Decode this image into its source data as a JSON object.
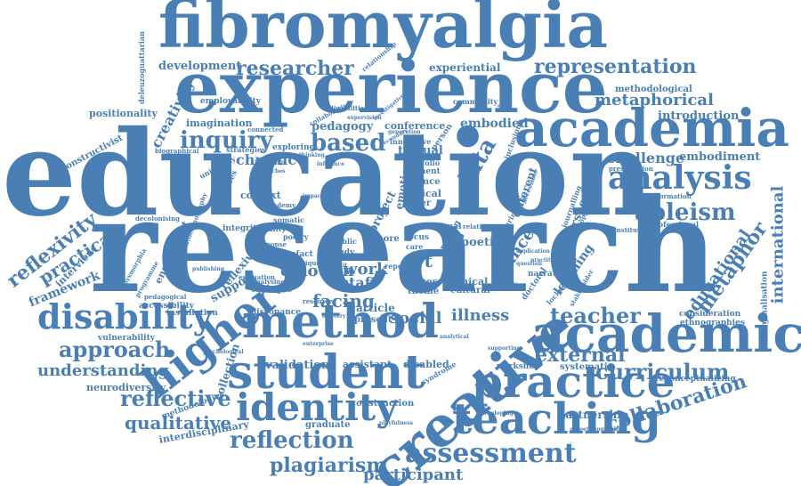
{
  "color": "#4a7fb5",
  "words": {
    "fibromyalgia": "fibromyalgia",
    "experience": "experience",
    "education": "education",
    "research": "research",
    "academia": "academia",
    "method": "method",
    "academic": "academic",
    "student": "student",
    "practice": "practice",
    "creative": "creative",
    "teaching": "teaching",
    "identity": "identity",
    "higher": "higher",
    "disability": "disability",
    "analysis": "analysis",
    "representation": "representation",
    "researcher": "researcher",
    "development": "development",
    "metaphorical": "metaphorical",
    "inquiry": "inquiry",
    "based": "based",
    "ableism": "ableism",
    "reflexivity": "reflexivity",
    "practical": "practical",
    "approach": "approach",
    "understanding": "understanding",
    "reflective": "reflective",
    "qualitative": "qualitative",
    "reflection": "reflection",
    "plagiarism": "plagiarism",
    "assessment": "assessment",
    "participant": "participant",
    "curriculum": "curriculum",
    "collaboration": "collaboration",
    "teacher": "teacher",
    "external": "external",
    "metaphor": "metaphor",
    "international": "international",
    "educational": "educational",
    "challenge": "challenge",
    "embodiment": "embodiment",
    "introduction": "introduction",
    "creativity": "creativity",
    "positionality": "positionality",
    "framework": "framework",
    "experiential": "experiential",
    "data": "data",
    "pedagogy": "pedagogy",
    "chronic": "chronic",
    "emotion": "emotion",
    "staff": "staff",
    "work": "work",
    "social": "social",
    "illness": "illness",
    "art": "art",
    "facing": "facing",
    "dance": "dance",
    "partnership": "partnership",
    "validation": "validation",
    "embodied": "embodied",
    "methodological": "methodological",
    "conference": "conference",
    "textual": "textual",
    "imagination": "imagination",
    "constructivist": "constructivist",
    "context": "context",
    "neurodiversity": "neurodiversity",
    "interdisciplinary": "interdisciplinary",
    "vulnerability": "vulnerability",
    "employability": "employability",
    "exploring": "exploring",
    "strategies": "strategies",
    "interview": "interview",
    "engagement": "engagement",
    "support": "support",
    "reflexive": "reflexive",
    "collection": "collection",
    "example": "example",
    "installation": "installation",
    "accessibility": "accessibility",
    "assistant": "assistant",
    "disabled": "disabled",
    "construction": "construction",
    "graduate": "graduate",
    "systematic": "systematic",
    "workshop": "workshop",
    "consideration": "consideration",
    "ethnographies": "ethnographies",
    "marginalisation": "marginalisation",
    "reconceptualizing": "reconceptualizing",
    "professional": "professional",
    "poetic": "poetic",
    "ethical": "ethical",
    "cultural": "cultural",
    "perspective": "perspective",
    "learning": "learning",
    "narrative": "narrative",
    "doctoral": "doctoral",
    "making": "making",
    "project": "project",
    "article": "article",
    "present": "present",
    "space": "space",
    "study": "study",
    "theme": "theme",
    "boxes": "boxes",
    "critical": "critical",
    "paper": "paper",
    "science": "science",
    "element": "element",
    "portfolio": "portfolio",
    "primary": "primary",
    "person": "person",
    "innovative": "innovative",
    "community": "community",
    "relationship": "relationship",
    "deleuzoguattarian": "deleuzoguattarian",
    "dissonance": "dissonance",
    "resource": "resource",
    "integrity": "integrity",
    "somatic": "somatic",
    "equality": "equality",
    "poetry": "poetry",
    "artefact": "artefact",
    "response": "response",
    "critique": "critique",
    "methodologies": "methodologies",
    "processes": "processes",
    "academy": "academy",
    "biographical": "biographical",
    "connected": "connected",
    "collaborative": "collaborative",
    "disabilities": "disabilities",
    "decolonising": "decolonising",
    "autoethnography": "autoethnography",
    "dysmorphia": "dysmorphia",
    "programme": "programme",
    "pedagogical": "pedagogical",
    "analysing": "analysing",
    "evaluation": "evaluation",
    "university": "university",
    "journalling": "journalling",
    "opportunities": "opportunities",
    "institutional": "institutional",
    "presentation": "presentation",
    "information": "information",
    "lockdown": "lockdown",
    "application": "application",
    "question": "question",
    "delivery": "delivery",
    "enterprise": "enterprise",
    "supporting": "supporting",
    "syndrome": "syndrome",
    "analytical": "analytical",
    "developing": "developing",
    "playfulness": "playfulness",
    "autoethnographic": "autoethnographic",
    "psychological": "psychological",
    "public": "public",
    "focus": "focus",
    "more": "more",
    "care": "care",
    "visual": "visual",
    "relation": "relation",
    "report": "report",
    "publishing": "publishing",
    "investigative": "investigative",
    "supervision": "supervision",
    "generation": "generation",
    "secondary": "secondary",
    "inclusion": "inclusion",
    "experimental": "experimental",
    "students": "students",
    "staffs": "staffs",
    "interpretation": "interpretation",
    "outcome": "outcome",
    "thinking": "thinking",
    "sharing": "sharing",
    "knowledge": "knowledge",
    "approaches": "approaches",
    "influence": "influence",
    "thematic": "thematic",
    "fiction": "fiction",
    "pedagogies": "pedagogies",
    "cognitive": "cognitive",
    "emotional": "emotional",
    "training": "training",
    "invisible": "invisible",
    "different": "different",
    "accessible": "accessible",
    "physical": "physical",
    "mental": "mental",
    "health": "health",
    "toolkit": "toolkit",
    "ethic": "ethic",
    "benefit": "benefit",
    "stakeholder": "stakeholder",
    "practitioner": "practitioner",
    "evidence": "evidence",
    "impact": "impact",
    "method2": "method",
    "practice2": "practice",
    "writing": "writing",
    "collective": "collective",
    "visualisation": "visualisation",
    "design": "design",
    "embodiment2": "embodiment",
    "narratives": "narratives",
    "movement": "movement",
    "image": "image",
    "photo": "photo",
    "voice": "voice"
  }
}
